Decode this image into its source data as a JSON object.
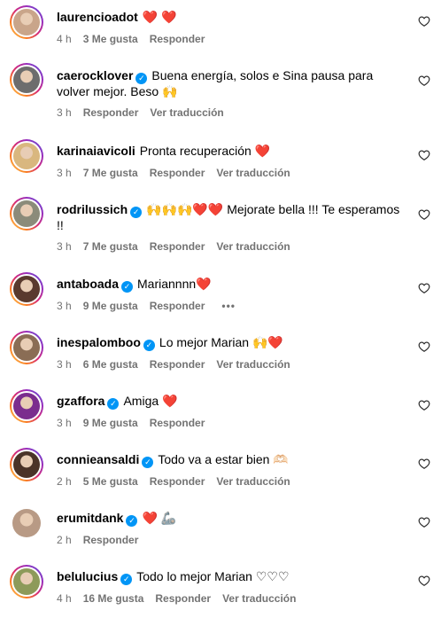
{
  "comments": [
    {
      "username": "laurencioadot",
      "verified": false,
      "text": "",
      "emoji": "❤️ ❤️",
      "time": "4 h",
      "likes": "3 Me gusta",
      "reply": "Responder",
      "translate": "",
      "avatar_color": "#c9a58a",
      "ring": true
    },
    {
      "username": "caerocklover",
      "verified": true,
      "text": "Buena energía, solos e Sina pausa para volver mejor. Beso 🙌",
      "emoji": "",
      "time": "3 h",
      "likes": "",
      "reply": "Responder",
      "translate": "Ver traducción",
      "avatar_color": "#6d6d6d",
      "ring": true
    },
    {
      "username": "karinaiavicoli",
      "verified": false,
      "text": "Pronta recuperación ❤️",
      "emoji": "",
      "time": "3 h",
      "likes": "7 Me gusta",
      "reply": "Responder",
      "translate": "Ver traducción",
      "avatar_color": "#d9b77f",
      "ring": true
    },
    {
      "username": "rodrilussich",
      "verified": true,
      "text": "🙌🙌🙌❤️❤️ Mejorate bella !!! Te esperamos !!",
      "emoji": "",
      "time": "3 h",
      "likes": "7 Me gusta",
      "reply": "Responder",
      "translate": "Ver traducción",
      "avatar_color": "#8b8b7a",
      "ring": true
    },
    {
      "username": "antaboada",
      "verified": true,
      "text": "Mariannnn❤️",
      "emoji": "",
      "time": "3 h",
      "likes": "9 Me gusta",
      "reply": "Responder",
      "translate": "",
      "more": "•••",
      "avatar_color": "#5a3a2e",
      "ring": true
    },
    {
      "username": "inespalomboo",
      "verified": true,
      "text": "Lo mejor Marian 🙌❤️",
      "emoji": "",
      "time": "3 h",
      "likes": "6 Me gusta",
      "reply": "Responder",
      "translate": "Ver traducción",
      "avatar_color": "#8a6d55",
      "ring": true
    },
    {
      "username": "gzaffora",
      "verified": true,
      "text": "Amiga ❤️",
      "emoji": "",
      "time": "3 h",
      "likes": "9 Me gusta",
      "reply": "Responder",
      "translate": "",
      "avatar_color": "#7b2d8e",
      "ring": true
    },
    {
      "username": "connieansaldi",
      "verified": true,
      "text": "Todo va a estar bien 🫶🏻",
      "emoji": "",
      "time": "2 h",
      "likes": "5 Me gusta",
      "reply": "Responder",
      "translate": "Ver traducción",
      "avatar_color": "#4a3328",
      "ring": true
    },
    {
      "username": "erumitdank",
      "verified": true,
      "text": "❤️ 🦾",
      "emoji": "",
      "time": "2 h",
      "likes": "",
      "reply": "Responder",
      "translate": "",
      "avatar_color": "#b89a85",
      "ring": false
    },
    {
      "username": "belulucius",
      "verified": true,
      "text": "Todo lo mejor Marian ♡♡♡",
      "emoji": "",
      "time": "4 h",
      "likes": "16 Me gusta",
      "reply": "Responder",
      "translate": "Ver traducción",
      "avatar_color": "#8d9a5a",
      "ring": true
    }
  ]
}
